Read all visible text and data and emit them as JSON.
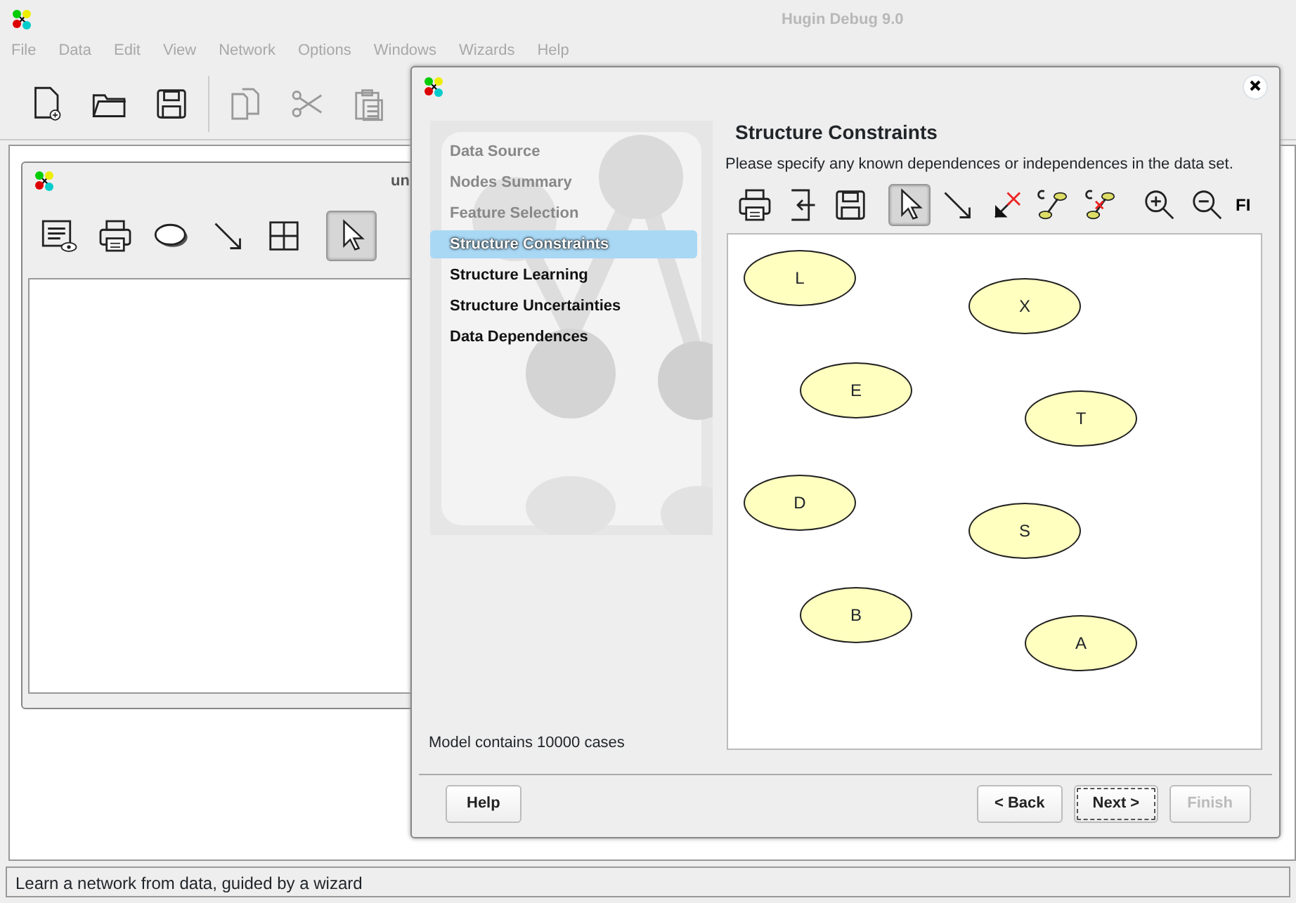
{
  "app": {
    "title": "Hugin Debug 9.0"
  },
  "menu": [
    {
      "label": "File",
      "disabled": true
    },
    {
      "label": "Data",
      "disabled": true
    },
    {
      "label": "Edit",
      "disabled": true
    },
    {
      "label": "View",
      "disabled": true
    },
    {
      "label": "Network",
      "disabled": true
    },
    {
      "label": "Options",
      "disabled": true
    },
    {
      "label": "Windows",
      "disabled": true
    },
    {
      "label": "Wizards",
      "disabled": true
    },
    {
      "label": "Help",
      "disabled": true
    }
  ],
  "toolbar": [
    {
      "kind": "new",
      "disabled": false
    },
    {
      "kind": "open",
      "disabled": false
    },
    {
      "kind": "save",
      "disabled": false
    },
    {
      "kind": "copy",
      "disabled": true
    },
    {
      "kind": "cut",
      "disabled": true
    },
    {
      "kind": "paste",
      "disabled": true
    }
  ],
  "network_window": {
    "title": "un",
    "tools": [
      {
        "kind": "view",
        "selected": false
      },
      {
        "kind": "print",
        "selected": false
      },
      {
        "kind": "node",
        "selected": false
      },
      {
        "kind": "link",
        "selected": false
      },
      {
        "kind": "table",
        "selected": false
      },
      {
        "kind": "pointer",
        "selected": true
      }
    ]
  },
  "wizard": {
    "steps": [
      {
        "label": "Data Source",
        "selected": false,
        "disabled": true
      },
      {
        "label": "Nodes Summary",
        "selected": false,
        "disabled": true
      },
      {
        "label": "Feature Selection",
        "selected": false,
        "disabled": true
      },
      {
        "label": "Structure Constraints",
        "selected": true,
        "disabled": false
      },
      {
        "label": "Structure Learning",
        "selected": false,
        "disabled": false
      },
      {
        "label": "Structure Uncertainties",
        "selected": false,
        "disabled": false
      },
      {
        "label": "Data Dependences",
        "selected": false,
        "disabled": false
      }
    ],
    "heading": "Structure Constraints",
    "description": "Please specify any known dependences or independences in the data set.",
    "tools": [
      {
        "kind": "print",
        "selected": false
      },
      {
        "kind": "import",
        "selected": false
      },
      {
        "kind": "save",
        "selected": false
      },
      {
        "kind": "pointer",
        "selected": true
      },
      {
        "kind": "link",
        "selected": false
      },
      {
        "kind": "nolink",
        "selected": false
      },
      {
        "kind": "constraint",
        "selected": false
      },
      {
        "kind": "noconstraint",
        "selected": false
      },
      {
        "kind": "zoomin",
        "selected": false
      },
      {
        "kind": "zoomout",
        "selected": false
      },
      {
        "kind": "text",
        "label": "FI",
        "selected": false
      }
    ],
    "nodes": [
      {
        "label": "L"
      },
      {
        "label": "X"
      },
      {
        "label": "E"
      },
      {
        "label": "T"
      },
      {
        "label": "D"
      },
      {
        "label": "S"
      },
      {
        "label": "B"
      },
      {
        "label": "A"
      }
    ],
    "info": "Model contains 10000 cases",
    "buttons": [
      {
        "label": "Help",
        "kind": "left",
        "focused": false,
        "disabled": false
      },
      {
        "label": "< Back",
        "kind": "right",
        "focused": false,
        "disabled": false
      },
      {
        "label": "Next >",
        "kind": "right",
        "focused": true,
        "disabled": false
      },
      {
        "label": "Finish",
        "kind": "right",
        "focused": false,
        "disabled": true
      }
    ]
  },
  "status_bar": "Learn a network from data, guided by a wizard"
}
